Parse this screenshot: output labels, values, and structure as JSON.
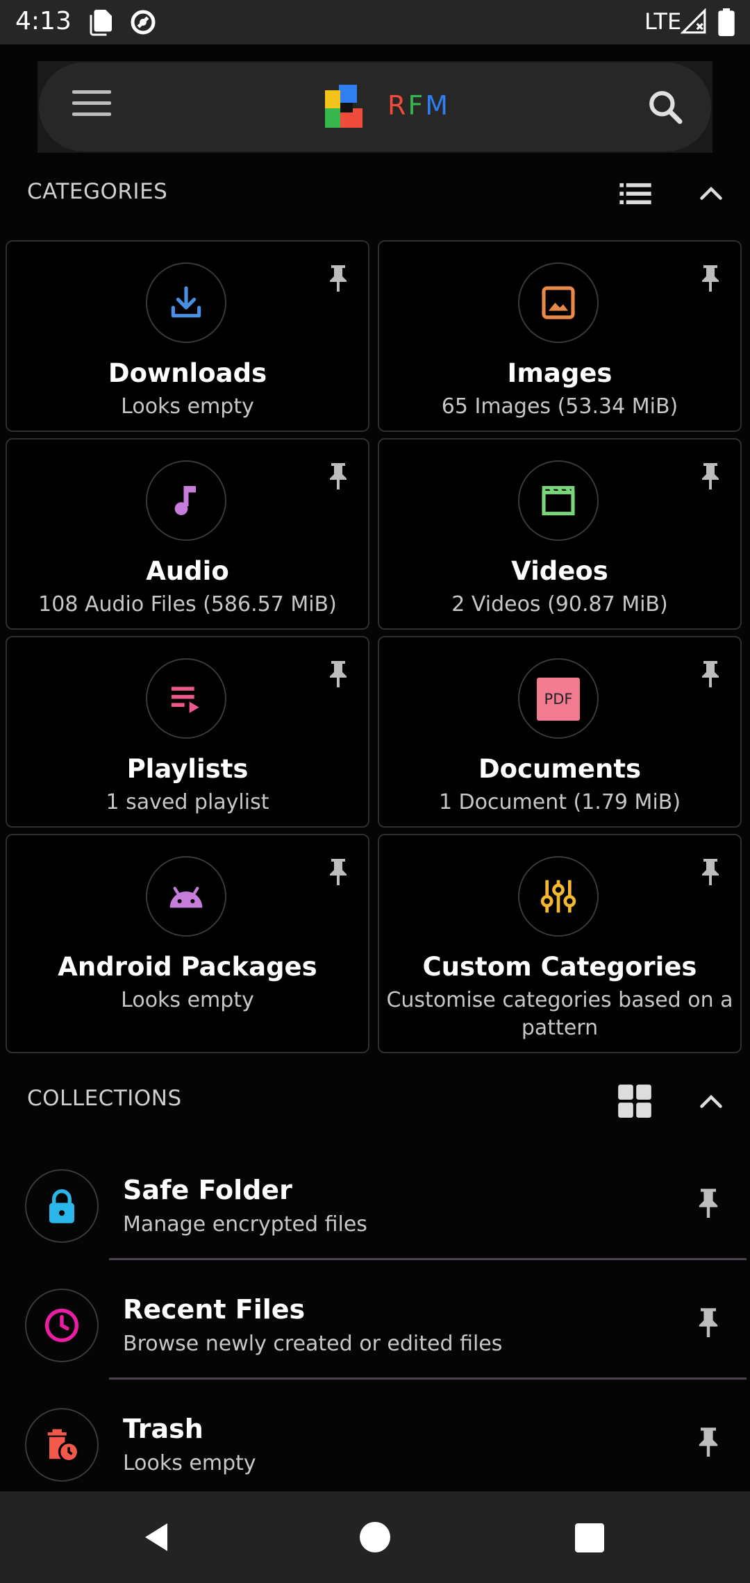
{
  "status_bar": {
    "time": "4:13",
    "network": "LTE"
  },
  "app_bar": {
    "brand": "RFM"
  },
  "categories_section": {
    "title": "CATEGORIES"
  },
  "categories": [
    {
      "title": "Downloads",
      "subtitle": "Looks empty",
      "icon": "download-icon",
      "color": "#4a90e2"
    },
    {
      "title": "Images",
      "subtitle": "65 Images (53.34 MiB)",
      "icon": "image-icon",
      "color": "#e8894a"
    },
    {
      "title": "Audio",
      "subtitle": "108 Audio Files (586.57 MiB)",
      "icon": "music-note-icon",
      "color": "#c77ddb"
    },
    {
      "title": "Videos",
      "subtitle": "2 Videos (90.87 MiB)",
      "icon": "movie-icon",
      "color": "#79d67a"
    },
    {
      "title": "Playlists",
      "subtitle": "1 saved playlist",
      "icon": "playlist-icon",
      "color": "#f0578f"
    },
    {
      "title": "Documents",
      "subtitle": "1 Document (1.79 MiB)",
      "icon": "pdf-icon",
      "color": "#f27b91",
      "icon_text": "PDF"
    },
    {
      "title": "Android Packages",
      "subtitle": "Looks empty",
      "icon": "android-icon",
      "color": "#c77ddb"
    },
    {
      "title": "Custom Categories",
      "subtitle": "Customise categories based on a pattern",
      "icon": "tune-icon",
      "color": "#f5b82e"
    }
  ],
  "collections_section": {
    "title": "COLLECTIONS"
  },
  "collections": [
    {
      "title": "Safe Folder",
      "subtitle": "Manage encrypted files",
      "icon": "lock-icon",
      "color": "#29b6e8"
    },
    {
      "title": "Recent Files",
      "subtitle": "Browse newly created or edited files",
      "icon": "clock-icon",
      "color": "#e91ea3"
    },
    {
      "title": "Trash",
      "subtitle": "Looks empty",
      "icon": "trash-clock-icon",
      "color": "#f2594b"
    }
  ]
}
